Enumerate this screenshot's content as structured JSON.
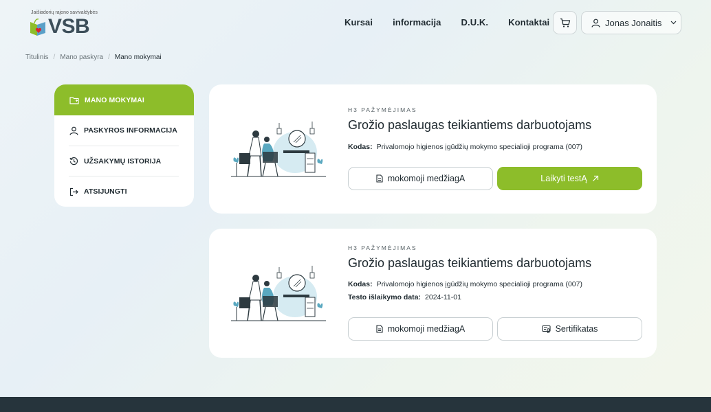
{
  "header": {
    "logo_small": "Jaišiadorių rajono savivaldybės",
    "logo_big": "VSB",
    "nav": [
      "Kursai",
      "informacija",
      "D.U.K.",
      "Kontaktai"
    ],
    "user_name": "Jonas Jonaitis"
  },
  "breadcrumb": [
    "Titulinis",
    "Mano paskyra",
    "Mano mokymai"
  ],
  "sidebar": {
    "items": [
      {
        "label": "MANO MOKYMAI",
        "icon": "folder-icon",
        "active": true
      },
      {
        "label": "PASKYROS INFORMACIJA",
        "icon": "user-icon",
        "active": false
      },
      {
        "label": "UŽSAKYMŲ ISTORIJA",
        "icon": "history-icon",
        "active": false
      },
      {
        "label": "ATSIJUNGTI",
        "icon": "logout-icon",
        "active": false
      }
    ]
  },
  "courses": [
    {
      "category": "H3 PAŽYMĖJIMAS",
      "title": "Grožio paslaugas teikiantiems darbuotojams",
      "code_label": "Kodas:",
      "code_value": "Privalomojo higienos įgūdžių mokymo specialioji programa (007)",
      "btn_material": "mokomoji medžiagA",
      "btn_action": "Laikyti testĄ"
    },
    {
      "category": "H3 PAŽYMĖJIMAS",
      "title": "Grožio paslaugas teikiantiems darbuotojams",
      "code_label": "Kodas:",
      "code_value": "Privalomojo higienos įgūdžių mokymo specialioji programa (007)",
      "date_label": "Testo išlaikymo data:",
      "date_value": "2024-11-01",
      "btn_material": "mokomoji medžiagA",
      "btn_action": "Sertifikatas"
    }
  ],
  "colors": {
    "accent": "#8dbd2a",
    "footer": "#26343c"
  }
}
